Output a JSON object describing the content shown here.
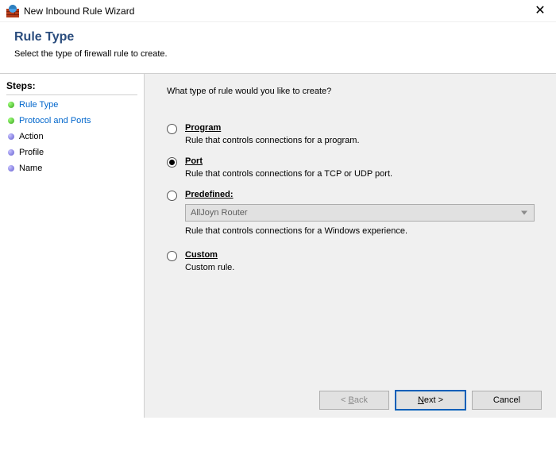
{
  "window": {
    "title": "New Inbound Rule Wizard",
    "close_glyph": "✕"
  },
  "header": {
    "title": "Rule Type",
    "subtitle": "Select the type of firewall rule to create."
  },
  "sidebar": {
    "title": "Steps:",
    "items": [
      {
        "label": "Rule Type",
        "state": "done",
        "link": true
      },
      {
        "label": "Protocol and Ports",
        "state": "done",
        "link": true
      },
      {
        "label": "Action",
        "state": "pending",
        "link": false
      },
      {
        "label": "Profile",
        "state": "pending",
        "link": false
      },
      {
        "label": "Name",
        "state": "pending",
        "link": false
      }
    ]
  },
  "content": {
    "prompt": "What type of rule would you like to create?",
    "options": {
      "program": {
        "label": "Program",
        "desc": "Rule that controls connections for a program."
      },
      "port": {
        "label": "Port",
        "desc": "Rule that controls connections for a TCP or UDP port."
      },
      "predefined": {
        "label": "Predefined:",
        "value": "AllJoyn Router",
        "desc": "Rule that controls connections for a Windows experience."
      },
      "custom": {
        "label": "Custom",
        "desc": "Custom rule."
      }
    },
    "selected": "port"
  },
  "footer": {
    "back_prefix": "< ",
    "back_letter": "B",
    "back_rest": "ack",
    "next_letter": "N",
    "next_rest": "ext >",
    "cancel": "Cancel"
  }
}
